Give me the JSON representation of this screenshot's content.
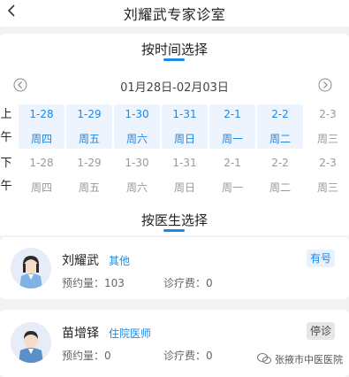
{
  "header": {
    "title": "刘耀武专家诊室"
  },
  "time_section": {
    "title": "按时间选择",
    "date_range": "01月28日-02月03日",
    "morning_label": [
      "上",
      "午"
    ],
    "afternoon_label": [
      "下",
      "午"
    ],
    "morning_slots": [
      {
        "date": "1-28",
        "weekday": "周四",
        "available": true
      },
      {
        "date": "1-29",
        "weekday": "周五",
        "available": true
      },
      {
        "date": "1-30",
        "weekday": "周六",
        "available": true
      },
      {
        "date": "1-31",
        "weekday": "周日",
        "available": true
      },
      {
        "date": "2-1",
        "weekday": "周一",
        "available": true
      },
      {
        "date": "2-2",
        "weekday": "周二",
        "available": true
      },
      {
        "date": "2-3",
        "weekday": "周三",
        "available": false
      }
    ],
    "afternoon_slots": [
      {
        "date": "1-28",
        "weekday": "周四",
        "available": false
      },
      {
        "date": "1-29",
        "weekday": "周五",
        "available": false
      },
      {
        "date": "1-30",
        "weekday": "周六",
        "available": false
      },
      {
        "date": "1-31",
        "weekday": "周日",
        "available": false
      },
      {
        "date": "2-1",
        "weekday": "周一",
        "available": false
      },
      {
        "date": "2-2",
        "weekday": "周二",
        "available": false
      },
      {
        "date": "2-3",
        "weekday": "周三",
        "available": false
      }
    ]
  },
  "doctor_section": {
    "title": "按医生选择",
    "doctors": [
      {
        "name": "刘耀武",
        "title": "其他",
        "booked_label": "预约量：103",
        "fee_label": "诊疗费：0",
        "status": "有号",
        "status_open": true
      },
      {
        "name": "苗增铎",
        "title": "住院医师",
        "booked_label": "预约量：0",
        "fee_label": "诊疗费：0",
        "status": "停诊",
        "status_open": false
      }
    ]
  },
  "watermark": {
    "text": "张掖市中医医院"
  },
  "colors": {
    "accent": "#1e88e5",
    "slot_bg": "#eef4fd",
    "muted": "#999999",
    "page_bg": "#f2f3f5"
  }
}
